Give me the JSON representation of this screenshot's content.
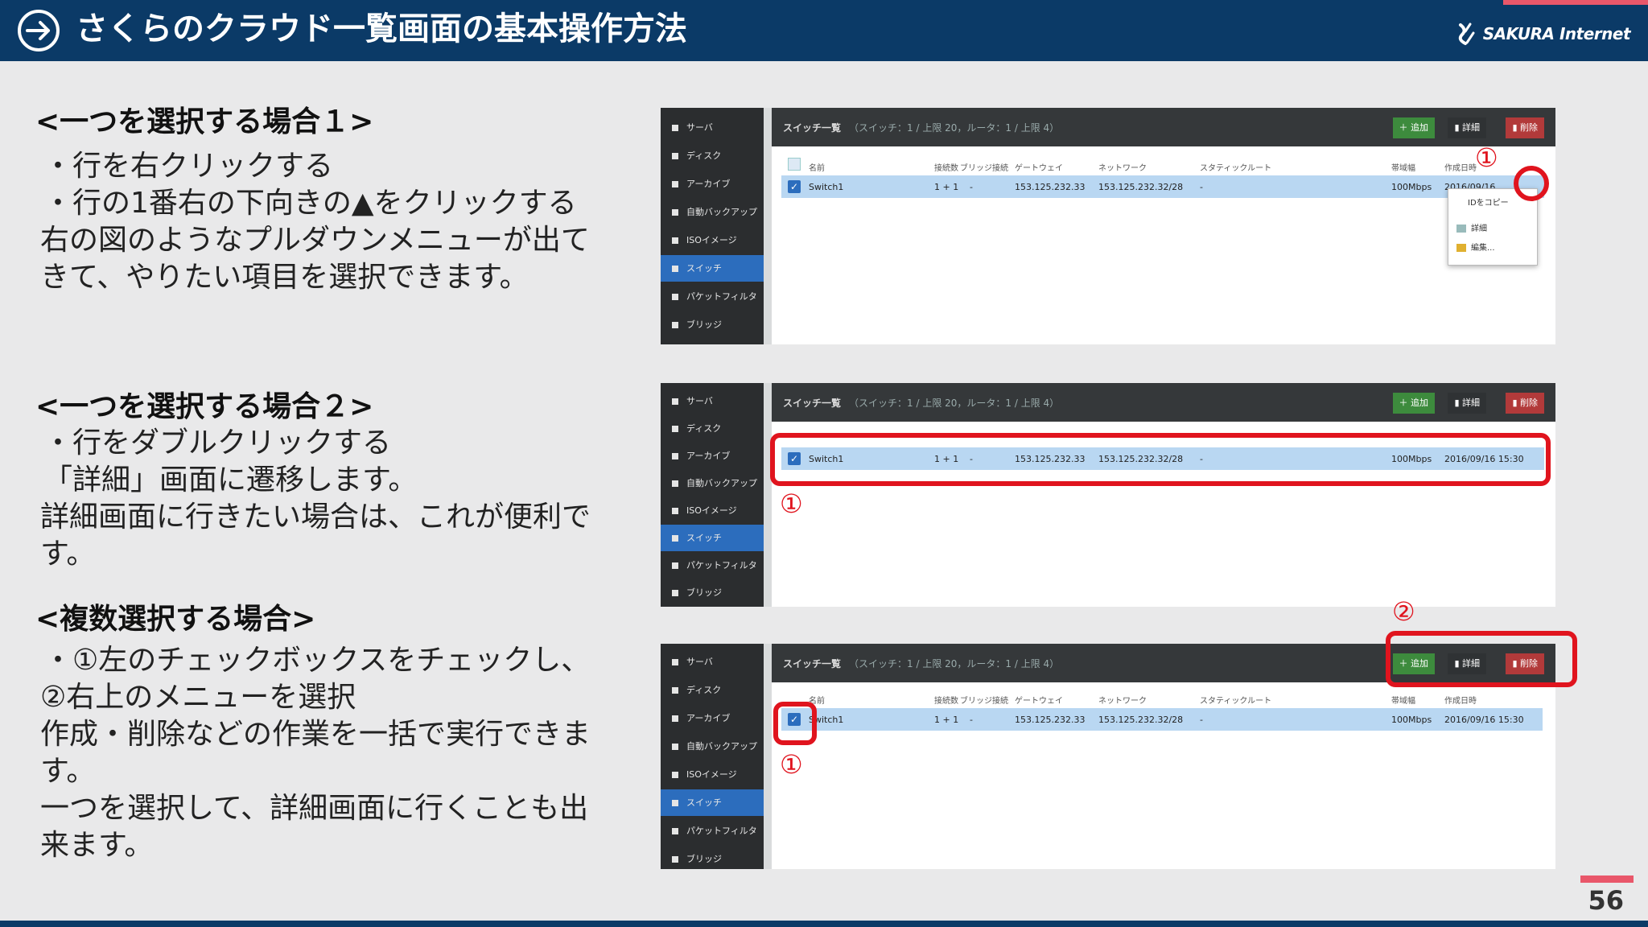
{
  "header": {
    "title": "さくらのクラウド一覧画面の基本操作方法",
    "brand": "SAKURA Internet",
    "brand_color": "#0b3a67",
    "accent_color": "#e9576a",
    "icons": [
      "arrow-circle-icon",
      "sakura-logo-icon"
    ]
  },
  "sections": [
    {
      "heading": "<一つを選択する場合１>",
      "lines": [
        "・行を右クリックする",
        "・行の1番右の下向きの▲をクリックする",
        "右の図のようなプルダウンメニューが出て",
        "きて、やりたい項目を選択できます。"
      ]
    },
    {
      "heading": "<一つを選択する場合２>",
      "lines": [
        "・行をダブルクリックする",
        "「詳細」画面に遷移します。",
        "詳細画面に行きたい場合は、これが便利で",
        "す。"
      ]
    },
    {
      "heading": "<複数選択する場合>",
      "lines": [
        "・①左のチェックボックスをチェックし、",
        "②右上のメニューを選択",
        "作成・削除などの作業を一括で実行できま",
        "す。",
        "一つを選択して、詳細画面に行くことも出",
        "来ます。"
      ]
    }
  ],
  "ui": {
    "sidebar": [
      "サーバ",
      "ディスク",
      "アーカイブ",
      "自動バックアップ",
      "ISOイメージ",
      "スイッチ",
      "パケットフィルタ",
      "ブリッジ"
    ],
    "active_item": "スイッチ",
    "list_title": "スイッチ一覧",
    "list_sub": "（スイッチ：1 / 上限 20，ルータ：1 / 上限 4）",
    "buttons": {
      "add": "追加",
      "detail": "詳細",
      "delete": "削除"
    },
    "columns": [
      "名前",
      "接続数",
      "ブリッジ接続",
      "ゲートウェイ",
      "ネットワーク",
      "スタティックルート",
      "帯域幅",
      "作成日時"
    ],
    "row": {
      "name": "Switch1",
      "connections": "1 + 1",
      "bridge": "-",
      "gateway": "153.125.232.33",
      "network": "153.125.232.32/28",
      "static_route": "-",
      "bandwidth": "100Mbps",
      "created": "2016/09/16 15:30"
    },
    "context_menu": [
      "IDをコピー",
      "詳細",
      "編集..."
    ]
  },
  "markers": {
    "one": "①",
    "two": "②"
  },
  "page_number": "56"
}
